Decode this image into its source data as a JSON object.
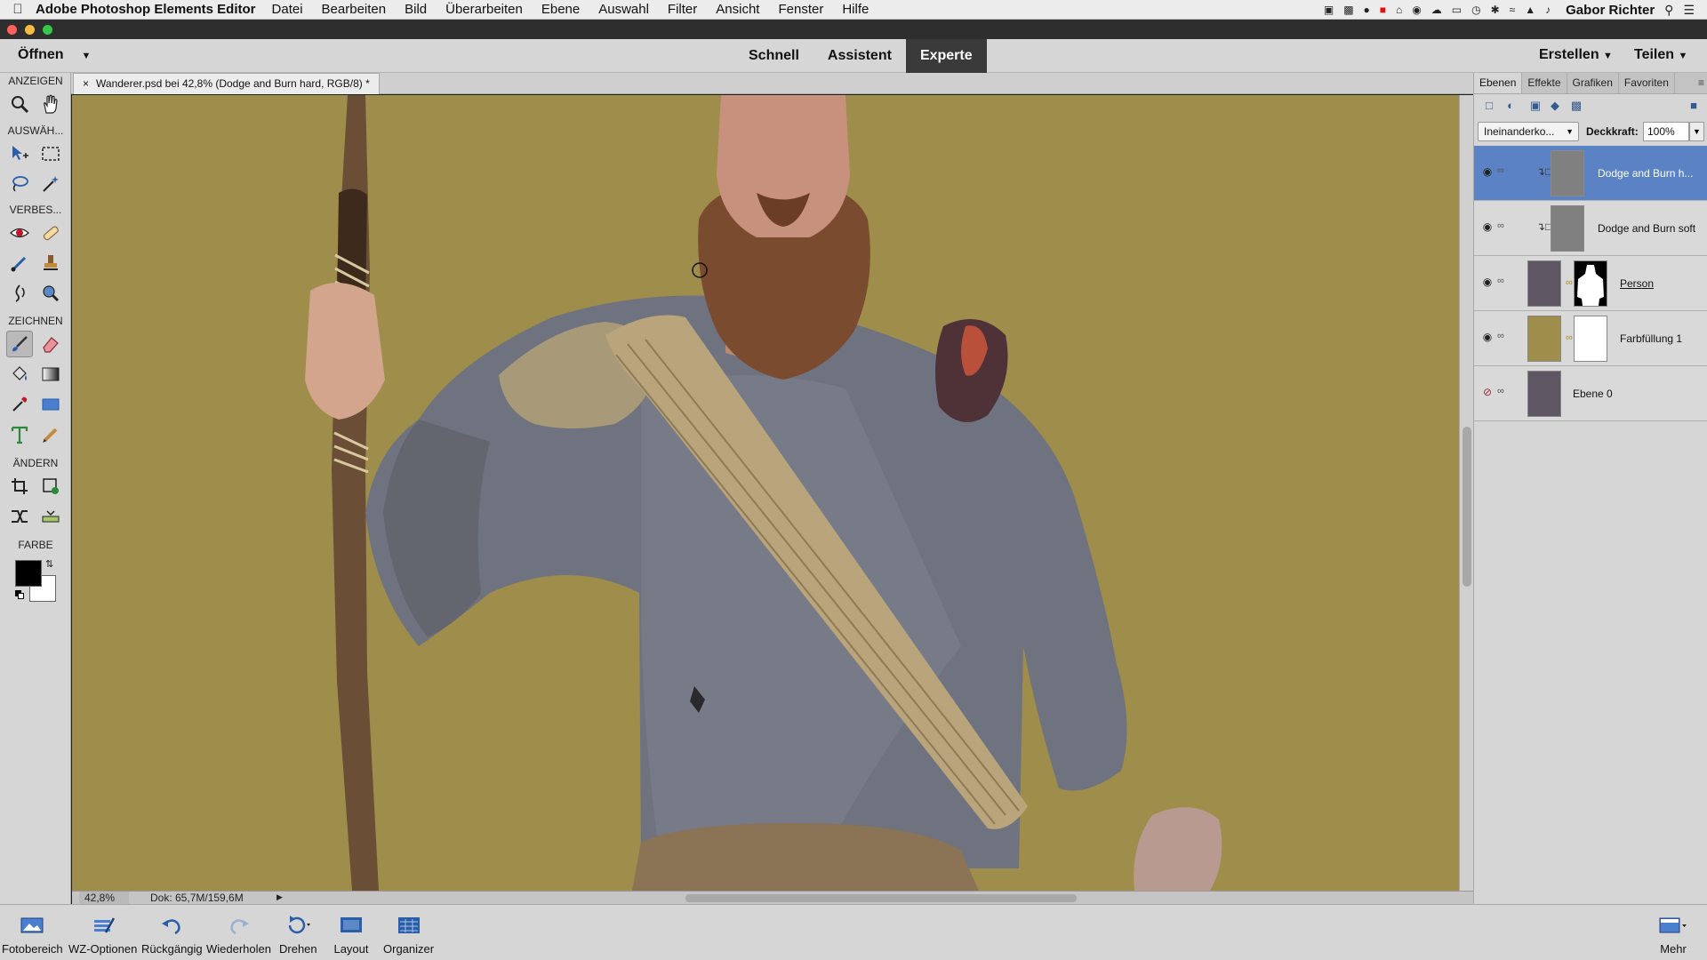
{
  "macbar": {
    "app_name": "Adobe Photoshop Elements Editor",
    "menus": [
      "Datei",
      "Bearbeiten",
      "Bild",
      "Überarbeiten",
      "Ebene",
      "Auswahl",
      "Filter",
      "Ansicht",
      "Fenster",
      "Hilfe"
    ],
    "user": "Gabor Richter"
  },
  "modebar": {
    "open_label": "Öffnen",
    "modes": [
      "Schnell",
      "Assistent",
      "Experte"
    ],
    "active_mode": "Experte",
    "create_label": "Erstellen",
    "share_label": "Teilen"
  },
  "toolbox": {
    "sections": [
      "ANZEIGEN",
      "AUSWÄH...",
      "VERBES...",
      "ZEICHNEN",
      "ÄNDERN",
      "FARBE"
    ],
    "foreground_color": "#000000",
    "background_color": "#ffffff"
  },
  "document": {
    "tab_title": "Wanderer.psd bei 42,8% (Dodge and Burn hard, RGB/8) *",
    "canvas_color": "#9e8d4b"
  },
  "status": {
    "zoom": "42,8%",
    "doc_size": "Dok: 65,7M/159,6M"
  },
  "panel": {
    "tabs": [
      "Ebenen",
      "Effekte",
      "Grafiken",
      "Favoriten"
    ],
    "active_tab": "Ebenen",
    "blend_mode": "Ineinanderko...",
    "opacity_label": "Deckkraft:",
    "opacity_value": "100%",
    "layers": [
      {
        "name": "Dodge and Burn h...",
        "selected": true,
        "visible": true
      },
      {
        "name": "Dodge and Burn soft",
        "selected": false,
        "visible": true
      },
      {
        "name": "Person",
        "selected": false,
        "visible": true
      },
      {
        "name": "Farbfüllung 1",
        "selected": false,
        "visible": true
      },
      {
        "name": "Ebene 0",
        "selected": false,
        "visible": false
      }
    ]
  },
  "bottombar": {
    "buttons": [
      "Fotobereich",
      "WZ-Optionen",
      "Rückgängig",
      "Wiederholen",
      "Drehen",
      "Layout",
      "Organizer"
    ],
    "more_label": "Mehr"
  }
}
